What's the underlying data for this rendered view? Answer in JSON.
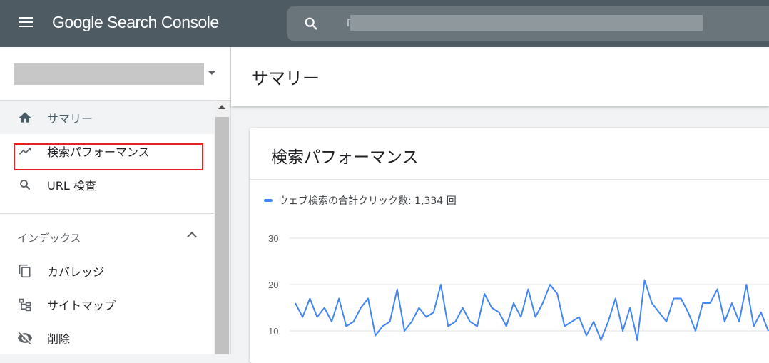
{
  "header": {
    "app_title": "Google Search Console",
    "search_value": "「"
  },
  "sidebar": {
    "nav": [
      {
        "label": "サマリー",
        "icon": "home-icon"
      },
      {
        "label": "検索パフォーマンス",
        "icon": "trending-up-icon"
      },
      {
        "label": "URL 検査",
        "icon": "search-icon"
      }
    ],
    "section_title": "インデックス",
    "section_items": [
      {
        "label": "カバレッジ",
        "icon": "copy-icon"
      },
      {
        "label": "サイトマップ",
        "icon": "sitemap-icon"
      },
      {
        "label": "削除",
        "icon": "visibility-off-icon"
      }
    ]
  },
  "main": {
    "page_title": "サマリー",
    "card_title": "検索パフォーマンス",
    "legend_text": "ウェブ検索の合計クリック数: 1,334 回"
  },
  "colors": {
    "topbar": "#4f5b62",
    "series": "#4285f4",
    "highlight": "#e8201f"
  },
  "chart_data": {
    "type": "line",
    "yticks": [
      30,
      20,
      10
    ],
    "ylim": [
      5,
      30
    ],
    "series": [
      {
        "name": "ウェブ検索の合計クリック数",
        "values": [
          16,
          13,
          17,
          13,
          15,
          12,
          17,
          11,
          12,
          15,
          17,
          9,
          11,
          12,
          19,
          10,
          12,
          15,
          13,
          14,
          20,
          11,
          12,
          15,
          12,
          11,
          18,
          15,
          14,
          11,
          16,
          13,
          19,
          13,
          16,
          20,
          18,
          11,
          12,
          13,
          9,
          12,
          8,
          12,
          17,
          10,
          15,
          8,
          21,
          16,
          14,
          12,
          17,
          17,
          14,
          10,
          16,
          16,
          19,
          12,
          16,
          12,
          20,
          11,
          14,
          10
        ]
      }
    ]
  }
}
